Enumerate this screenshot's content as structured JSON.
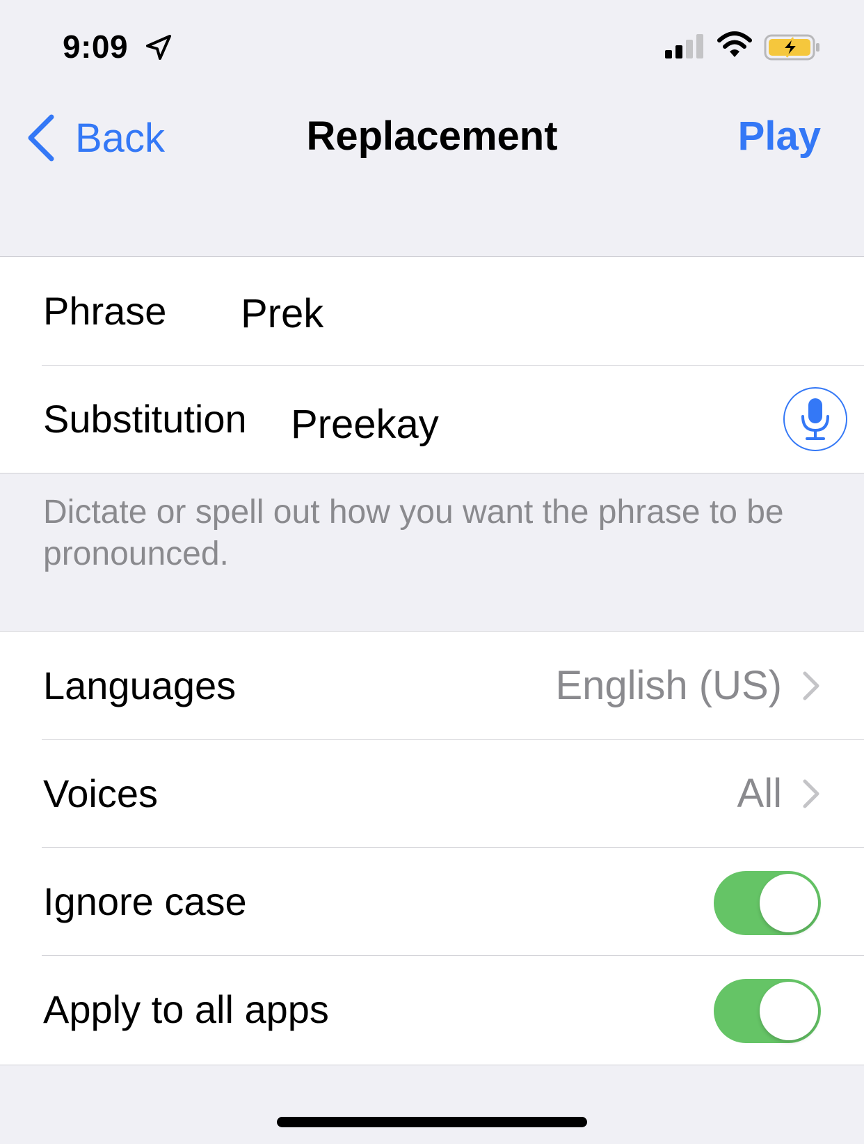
{
  "status_bar": {
    "time": "9:09",
    "location_icon": "location-arrow-icon",
    "signal_icon": "cellular-signal-icon",
    "wifi_icon": "wifi-icon",
    "battery_icon": "battery-charging-icon",
    "battery_color": "#f5c73d"
  },
  "nav": {
    "back_label": "Back",
    "title": "Replacement",
    "play_label": "Play",
    "accent_color": "#3478f6"
  },
  "replacement": {
    "phrase_label": "Phrase",
    "phrase_value": "Prek",
    "substitution_label": "Substitution",
    "substitution_value": "Preekay",
    "mic_icon": "microphone-icon",
    "footer": "Dictate or spell out how you want the phrase to be pronounced."
  },
  "options": {
    "languages_label": "Languages",
    "languages_value": "English (US)",
    "voices_label": "Voices",
    "voices_value": "All",
    "ignore_case_label": "Ignore case",
    "ignore_case_on": true,
    "apply_all_label": "Apply to all apps",
    "apply_all_on": true,
    "toggle_color": "#65c466"
  }
}
